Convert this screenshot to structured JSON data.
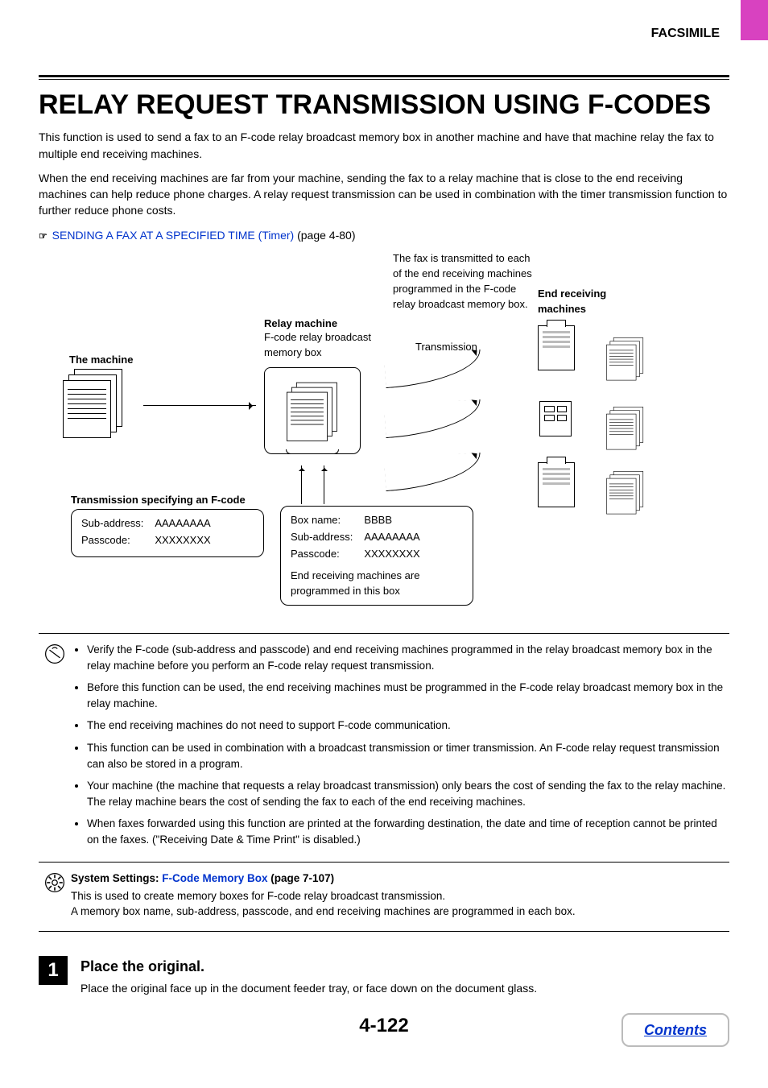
{
  "header": {
    "section": "FACSIMILE"
  },
  "title": "RELAY REQUEST TRANSMISSION USING F-CODES",
  "intro": {
    "p1": "This function is used to send a fax to an F-code relay broadcast memory box in another machine and have that machine relay the fax to multiple end receiving machines.",
    "p2": "When the end receiving machines are far from your machine, sending the fax to a relay machine that is close to the end receiving machines can help reduce phone charges. A relay request transmission can be used in combination with the timer transmission function to further reduce phone costs.",
    "link_text": "SENDING A FAX AT A SPECIFIED TIME (Timer)",
    "link_page": " (page 4-80)"
  },
  "diagram": {
    "the_machine": "The machine",
    "relay_title": "Relay machine",
    "relay_sub": "F-code relay broadcast memory box",
    "top_note": "The fax is transmitted to each of the end receiving machines programmed in the F-code relay broadcast memory box.",
    "transmission": "Transmission",
    "end_title": "End receiving machines",
    "fcode_caption": "Transmission specifying an F-code",
    "src_row1_k": "Sub-address:",
    "src_row1_v": "AAAAAAAA",
    "src_row2_k": "Passcode:",
    "src_row2_v": "XXXXXXXX",
    "box_row1_k": "Box name:",
    "box_row1_v": "BBBB",
    "box_row2_k": "Sub-address:",
    "box_row2_v": "AAAAAAAA",
    "box_row3_k": "Passcode:",
    "box_row3_v": "XXXXXXXX",
    "box_note": "End receiving machines are programmed in this box"
  },
  "notes": [
    "Verify the F-code (sub-address and passcode) and end receiving machines programmed in the relay broadcast memory box in the relay machine before you perform an F-code relay request transmission.",
    "Before this function can be used, the end receiving machines must be programmed in the F-code relay broadcast memory box in the relay machine.",
    "The end receiving machines do not need to support F-code communication.",
    "This function can be used in combination with a broadcast transmission or timer transmission. An F-code relay request transmission can also be stored in a program.",
    "Your machine (the machine that requests a relay broadcast transmission) only bears the cost of sending the fax to the relay machine. The relay machine bears the cost of sending the fax to each of the end receiving machines.",
    "When faxes forwarded using this function are printed at the forwarding destination, the date and time of reception cannot be printed on the faxes. (\"Receiving Date & Time Print\" is disabled.)"
  ],
  "settings": {
    "label": "System Settings:  ",
    "link": "F-Code Memory Box",
    "page": " (page 7-107)",
    "line1": "This is used to create memory boxes for F-code relay broadcast transmission.",
    "line2": "A memory box name, sub-address, passcode, and end receiving machines are programmed in each box."
  },
  "step": {
    "num": "1",
    "title": "Place the original.",
    "body": "Place the original face up in the document feeder tray, or face down on the document glass."
  },
  "page_number": "4-122",
  "contents_btn": "Contents"
}
